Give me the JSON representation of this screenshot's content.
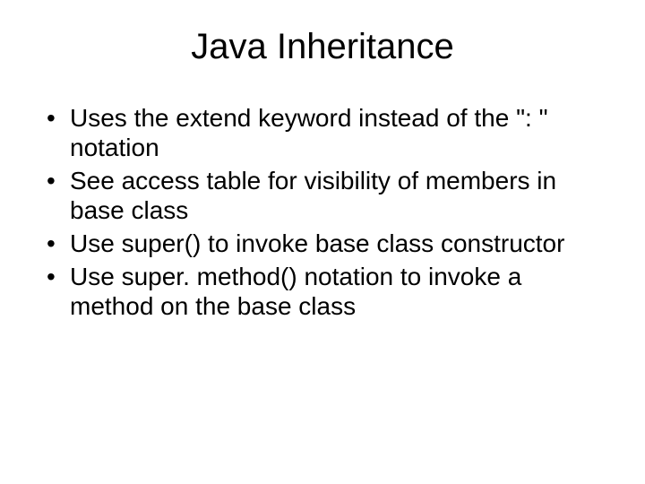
{
  "slide": {
    "title": "Java Inheritance",
    "bullets": [
      "Uses the extend keyword instead of the \": \" notation",
      "See access table for visibility of members in base class",
      "Use super() to invoke base class constructor",
      "Use super. method() notation to invoke a method on the base class"
    ]
  }
}
